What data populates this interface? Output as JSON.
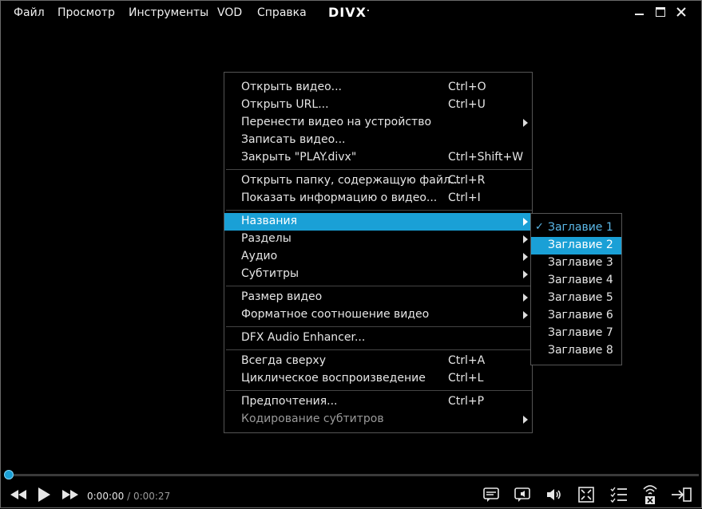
{
  "menubar": {
    "items": [
      "Файл",
      "Просмотр",
      "Инструменты",
      "VOD",
      "Справка"
    ],
    "logo": "DIVX",
    "logo_mark": "."
  },
  "context_menu": {
    "items": [
      {
        "label": "Открыть видео...",
        "shortcut": "Ctrl+O"
      },
      {
        "label": "Открыть URL...",
        "shortcut": "Ctrl+U"
      },
      {
        "label": "Перенести видео на устройство",
        "shortcut": ""
      },
      {
        "label": "Записать видео...",
        "shortcut": ""
      },
      {
        "label": "Закрыть \"PLAY.divx\"",
        "shortcut": "Ctrl+Shift+W"
      },
      {
        "label": "Открыть папку, содержащую файл...",
        "shortcut": "Ctrl+R"
      },
      {
        "label": "Показать информацию о видео...",
        "shortcut": "Ctrl+I"
      },
      {
        "label": "Названия",
        "shortcut": ""
      },
      {
        "label": "Разделы",
        "shortcut": ""
      },
      {
        "label": "Аудио",
        "shortcut": ""
      },
      {
        "label": "Субтитры",
        "shortcut": ""
      },
      {
        "label": "Размер видео",
        "shortcut": ""
      },
      {
        "label": "Форматное соотношение видео",
        "shortcut": ""
      },
      {
        "label": "DFX Audio Enhancer...",
        "shortcut": ""
      },
      {
        "label": "Всегда сверху",
        "shortcut": "Ctrl+A"
      },
      {
        "label": "Циклическое воспроизведение",
        "shortcut": "Ctrl+L"
      },
      {
        "label": "Предпочтения...",
        "shortcut": "Ctrl+P"
      },
      {
        "label": "Кодирование субтитров",
        "shortcut": ""
      }
    ]
  },
  "titles_submenu": {
    "items": [
      "Заглавие 1",
      "Заглавие 2",
      "Заглавие 3",
      "Заглавие 4",
      "Заглавие 5",
      "Заглавие 6",
      "Заглавие 7",
      "Заглавие 8"
    ],
    "checked": "Заглавие 1",
    "highlighted": "Заглавие 2"
  },
  "player": {
    "current_time": "0:00:00",
    "separator": " / ",
    "total_time": "0:00:27",
    "progress": 0.0
  },
  "colors": {
    "accent": "#1aa0d6",
    "background": "#000000",
    "text": "#e6e6e6"
  },
  "icons": [
    "rewind-icon",
    "play-icon",
    "fast-forward-icon",
    "subtitles-icon",
    "audio-track-icon",
    "volume-icon",
    "fullscreen-icon",
    "playlist-icon",
    "cast-icon",
    "exit-icon"
  ]
}
